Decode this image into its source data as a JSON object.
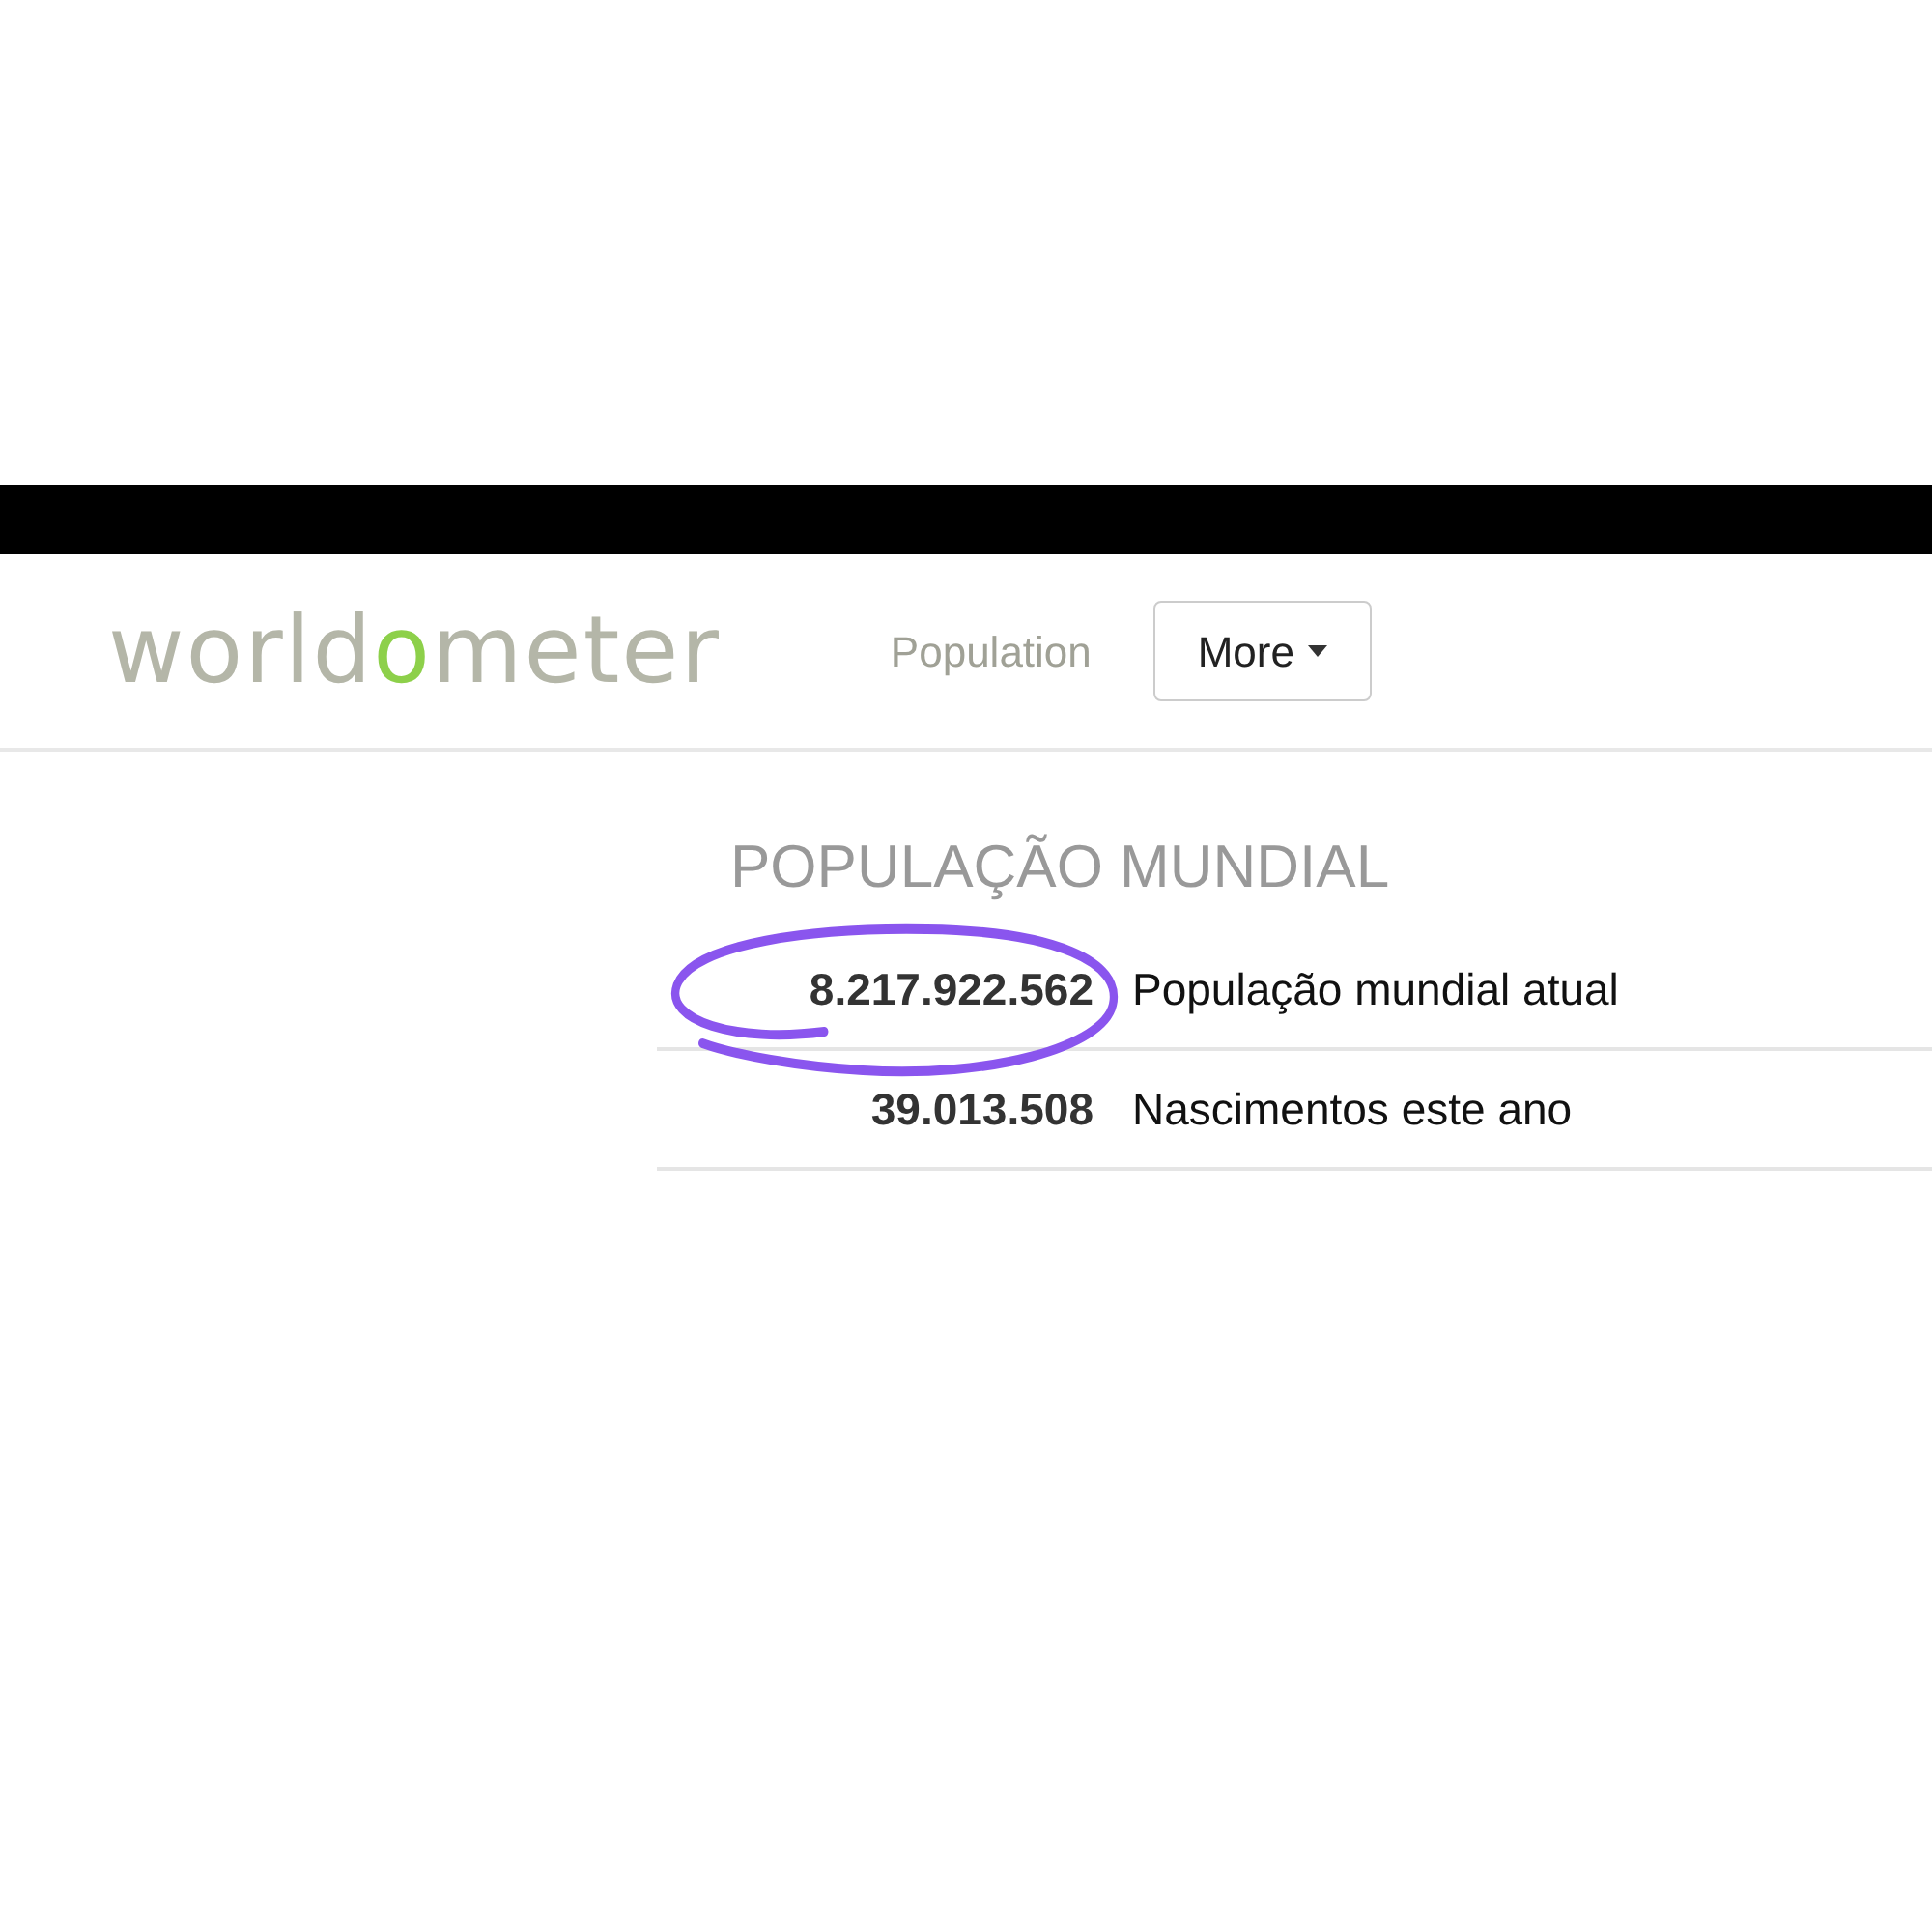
{
  "logo": {
    "before": "world",
    "accent": "o",
    "after": "meter"
  },
  "nav": {
    "link": "Population",
    "button": "More"
  },
  "heading": "POPULAÇÃO MUNDIAL",
  "rows": [
    {
      "value": "8.217.922.562",
      "label": "População mundial atual",
      "highlighted": true
    },
    {
      "value": "39.013.508",
      "label": "Nascimentos este ano",
      "highlighted": false
    }
  ]
}
